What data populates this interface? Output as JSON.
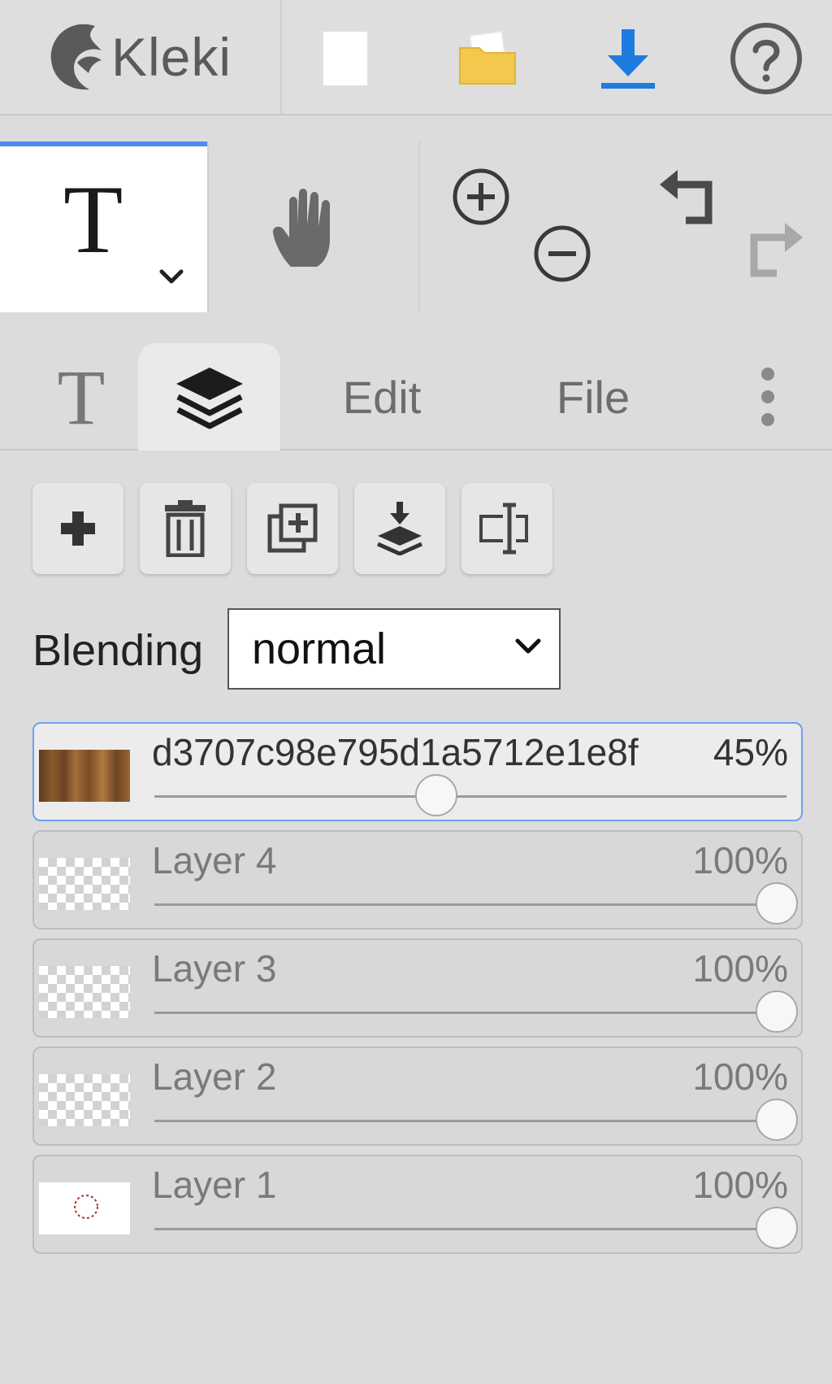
{
  "app": {
    "logo_text": "Kleki",
    "top_actions": [
      {
        "name": "new-image-button",
        "icon": "new-page-icon"
      },
      {
        "name": "open-file-button",
        "icon": "folder-icon"
      },
      {
        "name": "save-button",
        "icon": "download-icon"
      },
      {
        "name": "help-button",
        "icon": "help-icon"
      }
    ]
  },
  "toolbar": {
    "active_tool_glyph": "T",
    "tools": [
      "text-tool",
      "hand-tool",
      "zoom-in",
      "zoom-out",
      "undo",
      "redo"
    ]
  },
  "tabs": {
    "text_tab_glyph": "T",
    "edit": "Edit",
    "file": "File",
    "active": "layers"
  },
  "layers_panel": {
    "buttons": [
      "add-layer",
      "delete-layer",
      "duplicate-layer",
      "merge-down",
      "rename-layer"
    ],
    "blending_label": "Blending",
    "blending_value": "normal",
    "layers": [
      {
        "name": "d3707c98e795d1a5712e1e8f",
        "opacity_text": "45%",
        "opacity": 0.45,
        "active": true,
        "thumb": "wood"
      },
      {
        "name": "Layer 4",
        "opacity_text": "100%",
        "opacity": 1.0,
        "active": false,
        "thumb": "checker"
      },
      {
        "name": "Layer 3",
        "opacity_text": "100%",
        "opacity": 1.0,
        "active": false,
        "thumb": "checker"
      },
      {
        "name": "Layer 2",
        "opacity_text": "100%",
        "opacity": 1.0,
        "active": false,
        "thumb": "checker"
      },
      {
        "name": "Layer 1",
        "opacity_text": "100%",
        "opacity": 1.0,
        "active": false,
        "thumb": "white"
      }
    ]
  },
  "colors": {
    "accent": "#4a8ef0",
    "download_blue": "#1e7be0",
    "folder_yellow": "#f2c94c"
  }
}
